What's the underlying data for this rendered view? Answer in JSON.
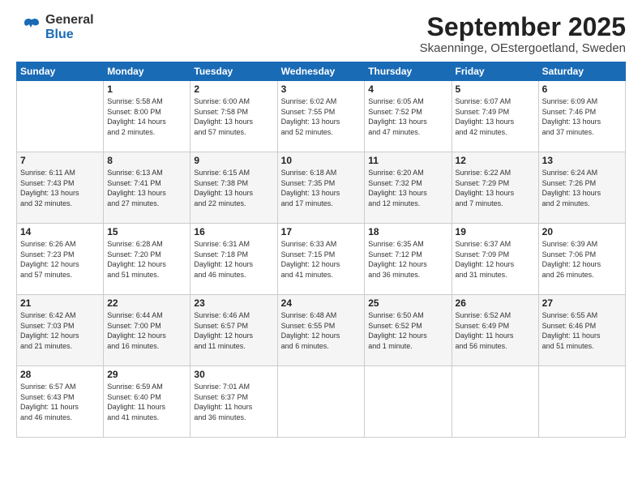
{
  "logo": {
    "general": "General",
    "blue": "Blue"
  },
  "title": "September 2025",
  "subtitle": "Skaenninge, OEstergoetland, Sweden",
  "days_of_week": [
    "Sunday",
    "Monday",
    "Tuesday",
    "Wednesday",
    "Thursday",
    "Friday",
    "Saturday"
  ],
  "weeks": [
    [
      {
        "day": "",
        "info": ""
      },
      {
        "day": "1",
        "info": "Sunrise: 5:58 AM\nSunset: 8:00 PM\nDaylight: 14 hours\nand 2 minutes."
      },
      {
        "day": "2",
        "info": "Sunrise: 6:00 AM\nSunset: 7:58 PM\nDaylight: 13 hours\nand 57 minutes."
      },
      {
        "day": "3",
        "info": "Sunrise: 6:02 AM\nSunset: 7:55 PM\nDaylight: 13 hours\nand 52 minutes."
      },
      {
        "day": "4",
        "info": "Sunrise: 6:05 AM\nSunset: 7:52 PM\nDaylight: 13 hours\nand 47 minutes."
      },
      {
        "day": "5",
        "info": "Sunrise: 6:07 AM\nSunset: 7:49 PM\nDaylight: 13 hours\nand 42 minutes."
      },
      {
        "day": "6",
        "info": "Sunrise: 6:09 AM\nSunset: 7:46 PM\nDaylight: 13 hours\nand 37 minutes."
      }
    ],
    [
      {
        "day": "7",
        "info": "Sunrise: 6:11 AM\nSunset: 7:43 PM\nDaylight: 13 hours\nand 32 minutes."
      },
      {
        "day": "8",
        "info": "Sunrise: 6:13 AM\nSunset: 7:41 PM\nDaylight: 13 hours\nand 27 minutes."
      },
      {
        "day": "9",
        "info": "Sunrise: 6:15 AM\nSunset: 7:38 PM\nDaylight: 13 hours\nand 22 minutes."
      },
      {
        "day": "10",
        "info": "Sunrise: 6:18 AM\nSunset: 7:35 PM\nDaylight: 13 hours\nand 17 minutes."
      },
      {
        "day": "11",
        "info": "Sunrise: 6:20 AM\nSunset: 7:32 PM\nDaylight: 13 hours\nand 12 minutes."
      },
      {
        "day": "12",
        "info": "Sunrise: 6:22 AM\nSunset: 7:29 PM\nDaylight: 13 hours\nand 7 minutes."
      },
      {
        "day": "13",
        "info": "Sunrise: 6:24 AM\nSunset: 7:26 PM\nDaylight: 13 hours\nand 2 minutes."
      }
    ],
    [
      {
        "day": "14",
        "info": "Sunrise: 6:26 AM\nSunset: 7:23 PM\nDaylight: 12 hours\nand 57 minutes."
      },
      {
        "day": "15",
        "info": "Sunrise: 6:28 AM\nSunset: 7:20 PM\nDaylight: 12 hours\nand 51 minutes."
      },
      {
        "day": "16",
        "info": "Sunrise: 6:31 AM\nSunset: 7:18 PM\nDaylight: 12 hours\nand 46 minutes."
      },
      {
        "day": "17",
        "info": "Sunrise: 6:33 AM\nSunset: 7:15 PM\nDaylight: 12 hours\nand 41 minutes."
      },
      {
        "day": "18",
        "info": "Sunrise: 6:35 AM\nSunset: 7:12 PM\nDaylight: 12 hours\nand 36 minutes."
      },
      {
        "day": "19",
        "info": "Sunrise: 6:37 AM\nSunset: 7:09 PM\nDaylight: 12 hours\nand 31 minutes."
      },
      {
        "day": "20",
        "info": "Sunrise: 6:39 AM\nSunset: 7:06 PM\nDaylight: 12 hours\nand 26 minutes."
      }
    ],
    [
      {
        "day": "21",
        "info": "Sunrise: 6:42 AM\nSunset: 7:03 PM\nDaylight: 12 hours\nand 21 minutes."
      },
      {
        "day": "22",
        "info": "Sunrise: 6:44 AM\nSunset: 7:00 PM\nDaylight: 12 hours\nand 16 minutes."
      },
      {
        "day": "23",
        "info": "Sunrise: 6:46 AM\nSunset: 6:57 PM\nDaylight: 12 hours\nand 11 minutes."
      },
      {
        "day": "24",
        "info": "Sunrise: 6:48 AM\nSunset: 6:55 PM\nDaylight: 12 hours\nand 6 minutes."
      },
      {
        "day": "25",
        "info": "Sunrise: 6:50 AM\nSunset: 6:52 PM\nDaylight: 12 hours\nand 1 minute."
      },
      {
        "day": "26",
        "info": "Sunrise: 6:52 AM\nSunset: 6:49 PM\nDaylight: 11 hours\nand 56 minutes."
      },
      {
        "day": "27",
        "info": "Sunrise: 6:55 AM\nSunset: 6:46 PM\nDaylight: 11 hours\nand 51 minutes."
      }
    ],
    [
      {
        "day": "28",
        "info": "Sunrise: 6:57 AM\nSunset: 6:43 PM\nDaylight: 11 hours\nand 46 minutes."
      },
      {
        "day": "29",
        "info": "Sunrise: 6:59 AM\nSunset: 6:40 PM\nDaylight: 11 hours\nand 41 minutes."
      },
      {
        "day": "30",
        "info": "Sunrise: 7:01 AM\nSunset: 6:37 PM\nDaylight: 11 hours\nand 36 minutes."
      },
      {
        "day": "",
        "info": ""
      },
      {
        "day": "",
        "info": ""
      },
      {
        "day": "",
        "info": ""
      },
      {
        "day": "",
        "info": ""
      }
    ]
  ]
}
